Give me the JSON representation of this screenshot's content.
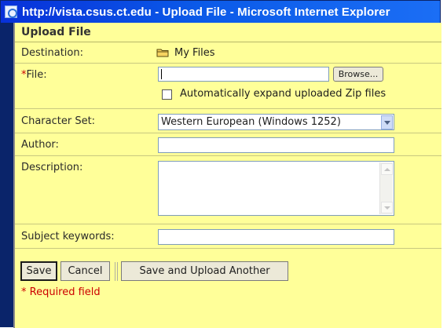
{
  "window": {
    "title": "http://vista.csus.ct.edu - Upload File - Microsoft Internet Explorer"
  },
  "form": {
    "heading": "Upload File",
    "destination": {
      "label": "Destination:",
      "value": "My Files"
    },
    "file": {
      "required_marker": "*",
      "label": "File:",
      "value": "",
      "browse_label": "Browse..."
    },
    "unzip": {
      "label": "Automatically expand uploaded Zip files",
      "checked": false
    },
    "charset": {
      "label": "Character Set:",
      "selected": "Western European (Windows 1252)"
    },
    "author": {
      "label": "Author:",
      "value": ""
    },
    "description": {
      "label": "Description:",
      "value": ""
    },
    "keywords": {
      "label": "Subject keywords:",
      "value": ""
    },
    "buttons": {
      "save": "Save",
      "cancel": "Cancel",
      "save_another": "Save and Upload Another"
    },
    "required_note": "* Required field"
  },
  "colors": {
    "titlebar": "#0b5ae8",
    "panel": "#ffff99",
    "required": "#cc0000"
  }
}
